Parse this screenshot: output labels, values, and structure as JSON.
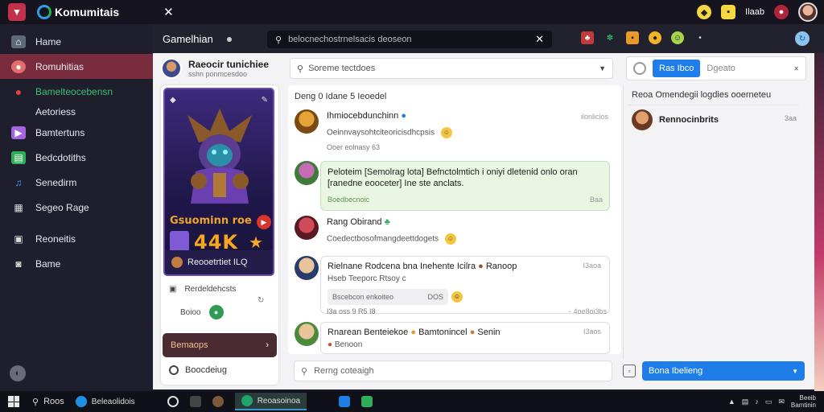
{
  "topbar": {
    "brand": "Komumitais",
    "close_glyph": "✕",
    "right_label": "Ilaab",
    "icons": [
      "controller-icon",
      "coin-icon",
      "record-icon",
      "user-avatar"
    ]
  },
  "sidebar": {
    "items": [
      {
        "label": "Hame",
        "icon": "home-icon"
      },
      {
        "label": "Romuhitias",
        "icon": "community-icon",
        "active": true
      },
      {
        "label": "Bamelteocebensn",
        "icon": "search-icon",
        "green": true
      },
      {
        "label": "Aetoriess",
        "icon": "",
        "sub": true
      },
      {
        "label": "Bamtertuns",
        "icon": "media-icon"
      },
      {
        "label": "Bedcdotiths",
        "icon": "library-icon"
      },
      {
        "label": "Senedirm",
        "icon": "music-icon"
      },
      {
        "label": "Segeo Rage",
        "icon": "grid-icon"
      },
      {
        "label": "Reoneitis",
        "icon": "store-icon"
      },
      {
        "label": "Bame",
        "icon": "camera-icon"
      }
    ]
  },
  "apphead": {
    "title": "Gamelhian",
    "search_text": "belocnechostrnelsacis deoseon",
    "right_icon": "refresh-icon"
  },
  "panel": {
    "profile_name": "Raeocir tunichiee",
    "profile_sub": "sshn ponmcesdoo",
    "filter_text": "Soreme tectdoes",
    "right_button": "Ras Ibco",
    "right_text": "Dgeato"
  },
  "gamecard": {
    "title": "Gsuominn roe",
    "score": "44K",
    "footer": "Reooetrtiet ILQ"
  },
  "leftcol": {
    "stat1": "Rerdeldehcsts",
    "stat2": "Boioo",
    "button": "Bemaops",
    "bottom": "Boocdeiug"
  },
  "chat": {
    "header": "Deng 0 Idane 5 Ieoedel",
    "messages": [
      {
        "name": "Ihmiocebdunchinn",
        "text": "Oeinnvaysohtciteoricisdhcpsis",
        "time": "ilonlicios",
        "meta": "Ooer eolnasy 63"
      },
      {
        "text": "Peloteim [Semolrag lota] Befnctolmtich i oniyi dletenid onlo oran [ranedne eooceter] Ine ste anclats.",
        "meta": "Boedbecnoic",
        "time": "Baa"
      },
      {
        "name": "Rang Obirand",
        "text": "Coedectbosofmangdeettdogets",
        "meta": ""
      },
      {
        "name": "Rielnane Rodcena bna Inehente Icilra",
        "extra": "Ranoop",
        "sub": "Hseb Teeporc Rtsoy c",
        "pill": "Bscebcon enkoiteo",
        "pill_count": "DOS",
        "time": "I3aoa",
        "meta": "I3a oss 9 R5 I8",
        "meta_right": "- 4oe8oi3bs"
      },
      {
        "name": "Rnarean Benteiekoe",
        "extra": "Bamtonincel",
        "extra2": "Senin",
        "sub": "Benoon",
        "time": "I3aos"
      }
    ]
  },
  "chat_search": "Rerng coteaigh",
  "rightcol": {
    "head": "Reoa Omendegii logdies ooerneteu",
    "user": "Rennocinbrits",
    "user_time": "3aa",
    "bottom_button": "Bona Ibelieng"
  },
  "taskbar": {
    "search": "Roos",
    "app1": "Beleaolidois",
    "app_active": "Reoasoinoa",
    "clock_time": "Beeib",
    "clock_date": "Bamtinin"
  },
  "colors": {
    "accent_blue": "#1e7de8",
    "active_sidebar": "#7a2c3f",
    "green": "#38c172"
  }
}
